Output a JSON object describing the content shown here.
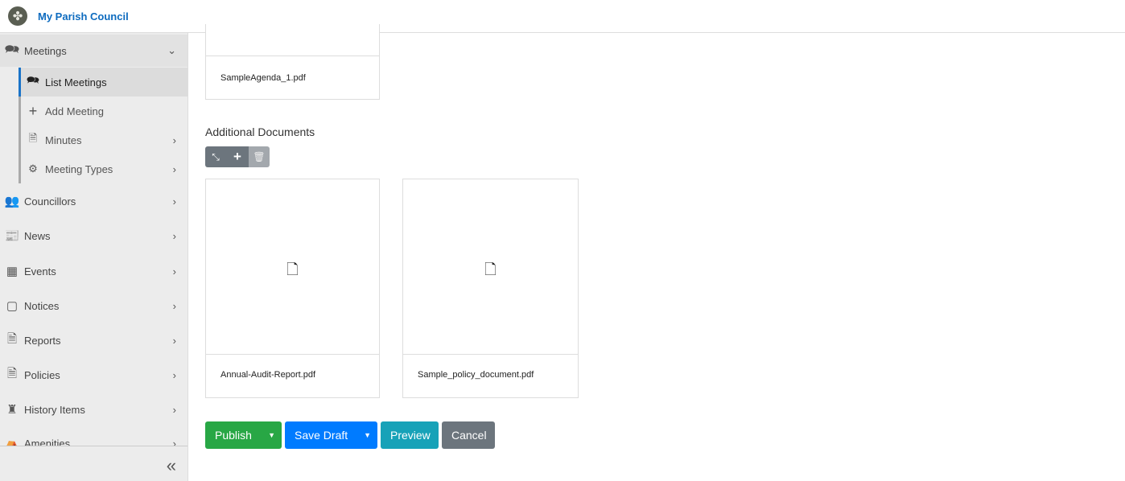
{
  "header": {
    "title": "My Parish Council",
    "logo_icon": "clover-logo"
  },
  "sidebar": {
    "meetings": "Meetings",
    "sub": [
      {
        "label": "List Meetings",
        "icon": "comments-icon"
      },
      {
        "label": "Add Meeting",
        "icon": "plus-icon"
      },
      {
        "label": "Minutes",
        "icon": "file-icon"
      },
      {
        "label": "Meeting Types",
        "icon": "gear-icon"
      }
    ],
    "items": [
      {
        "label": "Councillors"
      },
      {
        "label": "News"
      },
      {
        "label": "Events"
      },
      {
        "label": "Notices"
      },
      {
        "label": "Reports"
      },
      {
        "label": "Policies"
      },
      {
        "label": "History Items"
      },
      {
        "label": "Amenities"
      }
    ],
    "collapse": "«"
  },
  "main": {
    "agenda_file": "SampleAgenda_1.pdf",
    "additional_title": "Additional Documents",
    "files": [
      "Annual-Audit-Report.pdf",
      "Sample_policy_document.pdf"
    ],
    "buttons": {
      "publish": "Publish",
      "save_draft": "Save Draft",
      "preview": "Preview",
      "cancel": "Cancel"
    },
    "colors": {
      "publish": "#28a745",
      "save": "#007bff",
      "preview": "#17a2b8",
      "cancel": "#6c757d"
    }
  }
}
